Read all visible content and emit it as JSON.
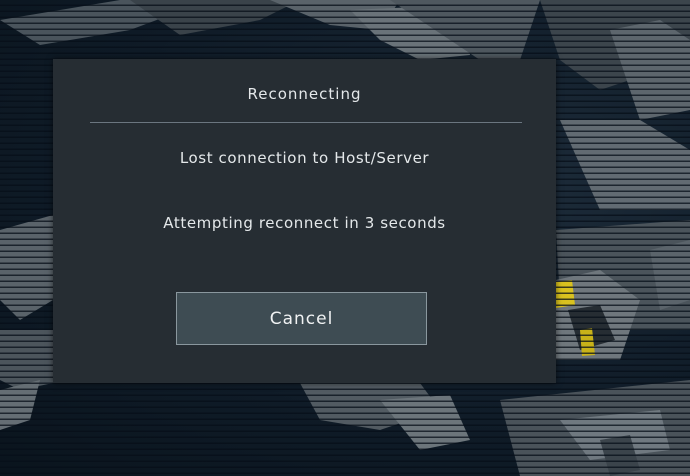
{
  "dialog": {
    "title": "Reconnecting",
    "lost_message": "Lost connection to Host/Server",
    "attempt_message": "Attempting reconnect in 3 seconds",
    "cancel_label": "Cancel"
  },
  "colors": {
    "dialog_bg": "#262d33",
    "button_bg": "#3e4c53",
    "text": "#e4e8ea",
    "accent_yellow": "#d9c21f"
  }
}
